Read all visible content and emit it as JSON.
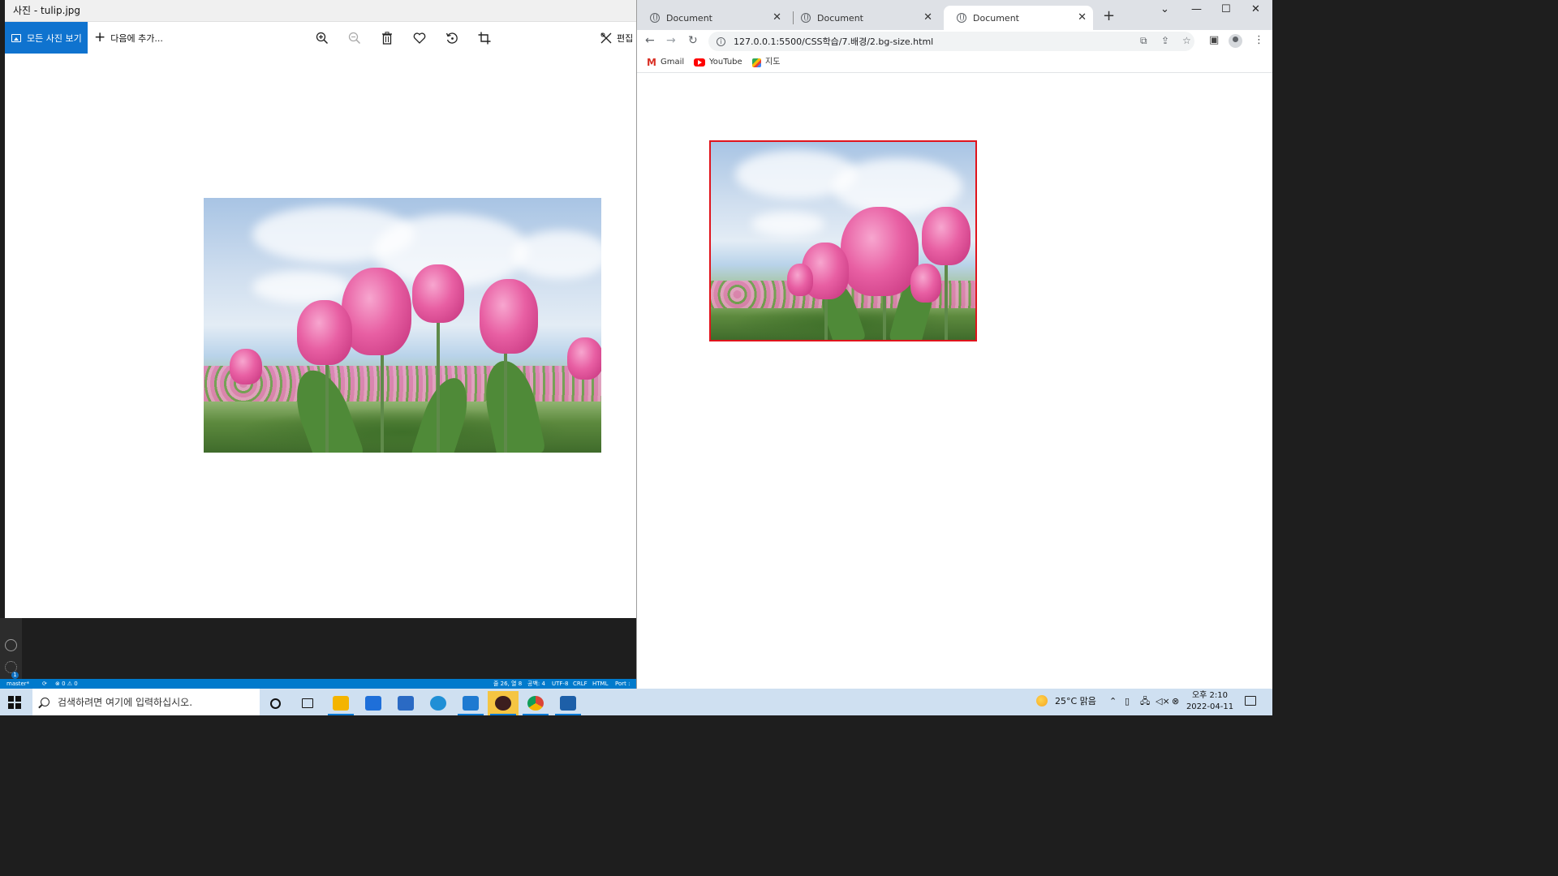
{
  "photos": {
    "title": "사진 - tulip.jpg",
    "all_photos_label": "모든 사진 보기",
    "add_to_label": "다음에 추가...",
    "edit_label": "편집",
    "toolbar_icons": [
      "zoom-in-icon",
      "zoom-out-icon",
      "delete-icon",
      "favorite-icon",
      "rotate-icon",
      "crop-icon"
    ]
  },
  "vscode": {
    "branch": "master*",
    "problems": "⊗ 0 ⚠ 0",
    "cursor": "줄 26, 열 8",
    "spaces": "공백: 4",
    "encoding": "UTF-8",
    "eol": "CRLF",
    "language": "HTML",
    "port": "Port :",
    "accounts_badge": "1"
  },
  "chrome": {
    "tabs": [
      {
        "label": "Document",
        "active": false
      },
      {
        "label": "Document",
        "active": false
      },
      {
        "label": "Document",
        "active": true
      }
    ],
    "url": "127.0.0.1:5500/CSS학습/7.배경/2.bg-size.html",
    "bookmarks": [
      "Gmail",
      "YouTube",
      "지도"
    ]
  },
  "taskbar": {
    "search_placeholder": "검색하려면 여기에 입력하십시오.",
    "weather": "25°C  맑음",
    "time": "오후 2:10",
    "date": "2022-04-11",
    "apps": [
      "file-explorer",
      "mail",
      "store",
      "edge",
      "vscode",
      "kakaotalk",
      "chrome",
      "photos"
    ],
    "colors": {
      "file_explorer": "#f4b400",
      "mail": "#1e6fd9",
      "store": "#2a6ac4",
      "edge": "#1f8fd6",
      "vscode": "#1e7ad1",
      "kakaotalk": "#3c1e1e",
      "chrome": "#db4437",
      "photos": "#1d5fa8"
    }
  },
  "colors": {
    "photos_accent": "#0f73cf",
    "vscode_status": "#007acc",
    "bg_box_border": "#e0141c",
    "taskbar_bg": "#cfe0f1"
  }
}
